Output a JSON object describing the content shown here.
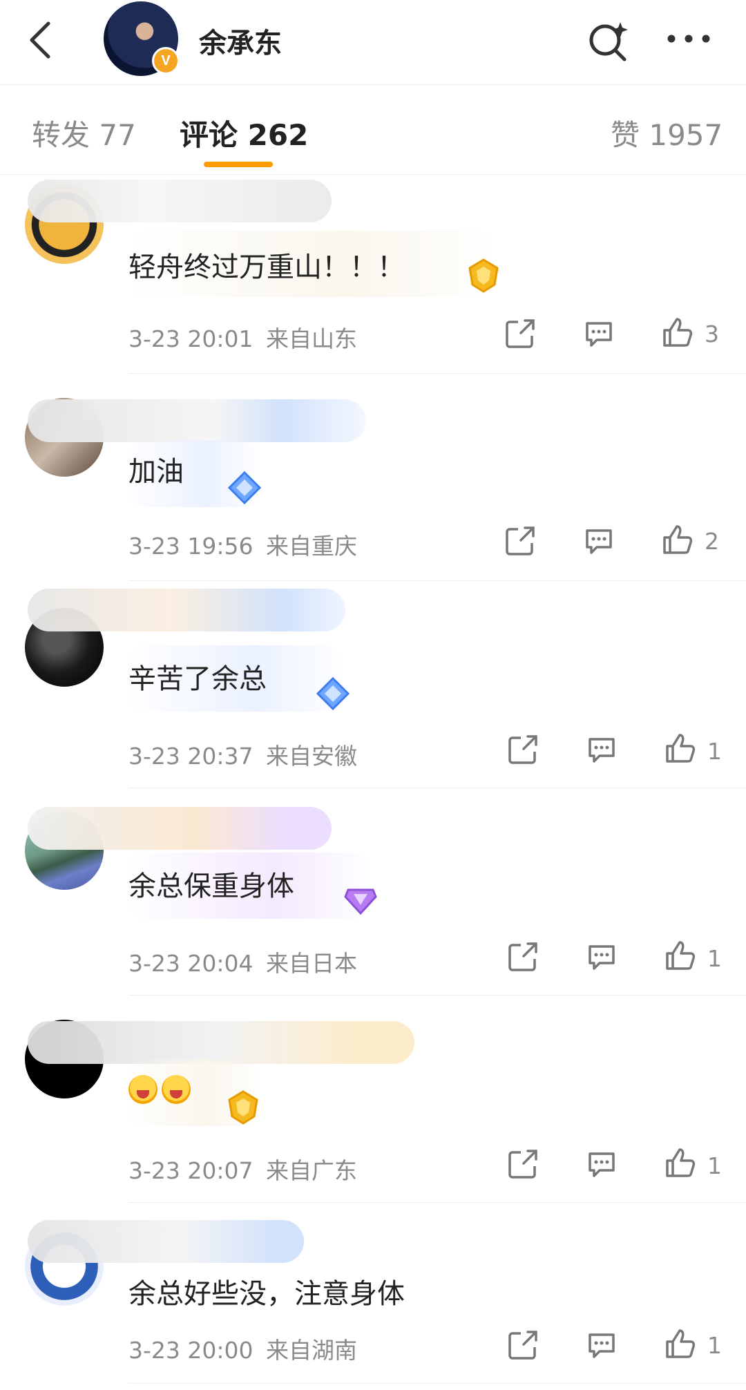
{
  "header": {
    "title": "余承东",
    "verified_badge": "V"
  },
  "tabs": [
    {
      "label": "转发 77"
    },
    {
      "label": "评论 262",
      "active": true
    },
    {
      "label": "赞 1957"
    }
  ],
  "comments": [
    {
      "text": "轻舟终过万重山！！！",
      "time": "3-23 20:01",
      "location": "来自山东",
      "likes": "3",
      "medal": "gold"
    },
    {
      "text": "加油",
      "time": "3-23 19:56",
      "location": "来自重庆",
      "likes": "2",
      "medal": "blue"
    },
    {
      "text": "辛苦了余总",
      "time": "3-23 20:37",
      "location": "来自安徽",
      "likes": "1",
      "medal": "blue"
    },
    {
      "text": "余总保重身体",
      "time": "3-23 20:04",
      "location": "来自日本",
      "likes": "1",
      "medal": "purple"
    },
    {
      "text": "",
      "time": "3-23 20:07",
      "location": "来自广东",
      "likes": "1",
      "medal": "gold"
    },
    {
      "text": "余总好些没，注意身体",
      "time": "3-23 20:00",
      "location": "来自湖南",
      "likes": "1",
      "medal": "none"
    }
  ],
  "colors": {
    "accent": "#ff9d00",
    "text": "#222222",
    "meta": "#8a8a8a"
  }
}
